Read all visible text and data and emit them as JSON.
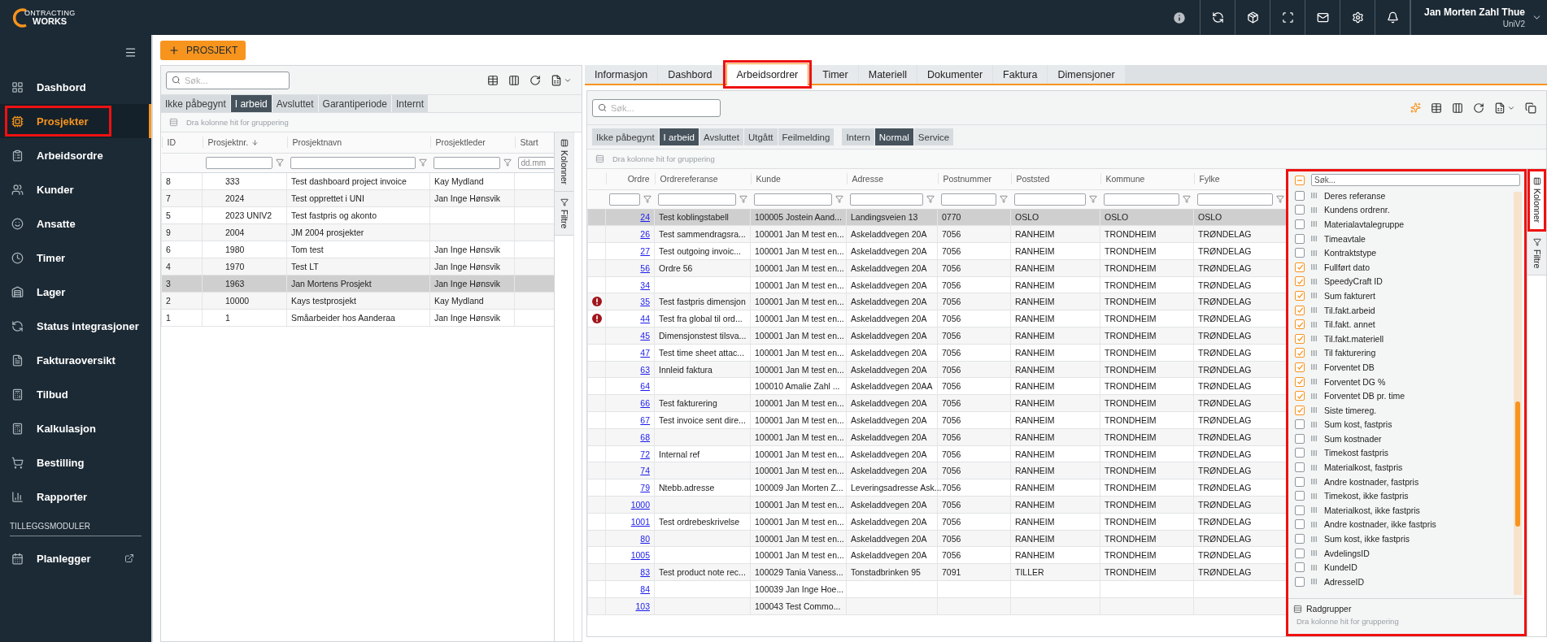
{
  "header": {
    "logo": {
      "line1": "ONTRACTING",
      "line2": "WORKS"
    },
    "user": {
      "name": "Jan Morten Zahl Thue",
      "company": "UniV2"
    }
  },
  "sidebar": {
    "items": [
      {
        "label": "Dashbord",
        "selected": false,
        "highlighted": false
      },
      {
        "label": "Prosjekter",
        "selected": true,
        "highlighted": true
      },
      {
        "label": "Arbeidsordre",
        "selected": false,
        "highlighted": false
      },
      {
        "label": "Kunder",
        "selected": false,
        "highlighted": false
      },
      {
        "label": "Ansatte",
        "selected": false,
        "highlighted": false
      },
      {
        "label": "Timer",
        "selected": false,
        "highlighted": false
      },
      {
        "label": "Lager",
        "selected": false,
        "highlighted": false
      },
      {
        "label": "Status integrasjoner",
        "selected": false,
        "highlighted": false
      },
      {
        "label": "Fakturaoversikt",
        "selected": false,
        "highlighted": false
      },
      {
        "label": "Tilbud",
        "selected": false,
        "highlighted": false
      },
      {
        "label": "Kalkulasjon",
        "selected": false,
        "highlighted": false
      },
      {
        "label": "Bestilling",
        "selected": false,
        "highlighted": false
      },
      {
        "label": "Rapporter",
        "selected": false,
        "highlighted": false
      }
    ],
    "section_title": "TILLEGGSMODULER",
    "module_items": [
      {
        "label": "Planlegger",
        "selected": false
      }
    ]
  },
  "new_project_button": "PROSJEKT",
  "project_list": {
    "search": {
      "placeholder": "Søk..."
    },
    "status_tabs": [
      {
        "label": "Ikke påbegynt",
        "selected": false
      },
      {
        "label": "I arbeid",
        "selected": true
      },
      {
        "label": "Avsluttet",
        "selected": false
      },
      {
        "label": "Garantiperiode",
        "selected": false
      },
      {
        "label": "Internt",
        "selected": false
      }
    ],
    "group_hint": "Dra kolonne hit for gruppering",
    "columns": [
      {
        "label": "ID",
        "sorted": false,
        "kind": "plain"
      },
      {
        "label": "Prosjektnr.",
        "sorted": true,
        "kind": "text"
      },
      {
        "label": "Prosjektnavn",
        "sorted": false,
        "kind": "text"
      },
      {
        "label": "Prosjektleder",
        "sorted": false,
        "kind": "text"
      },
      {
        "label": "Start",
        "sorted": false,
        "kind": "date",
        "placeholder": "dd.mm"
      }
    ],
    "rows": [
      {
        "cells": [
          "8",
          "333",
          "Test dashboard project invoice",
          "Kay Mydland"
        ],
        "selected": false
      },
      {
        "cells": [
          "7",
          "2024",
          "Test opprettet i UNI",
          "Jan Inge Hønsvik"
        ],
        "selected": false
      },
      {
        "cells": [
          "5",
          "2023 UNIV2",
          "Test fastpris og akonto"
        ],
        "selected": false
      },
      {
        "cells": [
          "9",
          "2004",
          "JM 2004 prosjekter"
        ],
        "selected": false
      },
      {
        "cells": [
          "6",
          "1980",
          "Tom test",
          "Jan Inge Hønsvik"
        ],
        "selected": false
      },
      {
        "cells": [
          "4",
          "1970",
          "Test LT",
          "Jan Inge Hønsvik"
        ],
        "selected": false
      },
      {
        "cells": [
          "3",
          "1963",
          "Jan Mortens Prosjekt",
          "Jan Inge Hønsvik"
        ],
        "selected": true
      },
      {
        "cells": [
          "2",
          "10000",
          "Kays testprosjekt",
          "Kay Mydland"
        ],
        "selected": false
      },
      {
        "cells": [
          "1",
          "1",
          "Småarbeider hos Aanderaa",
          "Jan Inge Hønsvik"
        ],
        "selected": false
      }
    ],
    "side_tabs": [
      {
        "label": "Kolonner",
        "selected": false
      },
      {
        "label": "Filtre",
        "selected": false
      }
    ]
  },
  "detail_tabs": [
    {
      "label": "Informasjon",
      "selected": false,
      "highlighted": false
    },
    {
      "label": "Dashbord",
      "selected": false,
      "highlighted": false
    },
    {
      "label": "Arbeidsordrer",
      "selected": true,
      "highlighted": true
    },
    {
      "label": "Timer",
      "selected": false,
      "highlighted": false
    },
    {
      "label": "Materiell",
      "selected": false,
      "highlighted": false
    },
    {
      "label": "Dokumenter",
      "selected": false,
      "highlighted": false
    },
    {
      "label": "Faktura",
      "selected": false,
      "highlighted": false
    },
    {
      "label": "Dimensjoner",
      "selected": false,
      "highlighted": false
    }
  ],
  "work_orders": {
    "search": {
      "placeholder": "Søk..."
    },
    "status_filters": [
      {
        "label": "Ikke påbegynt",
        "selected": false
      },
      {
        "label": "I arbeid",
        "selected": true
      },
      {
        "label": "Avsluttet",
        "selected": false
      },
      {
        "label": "Utgått",
        "selected": false
      },
      {
        "label": "Feilmelding",
        "selected": false
      }
    ],
    "type_filters": [
      {
        "label": "Intern",
        "selected": false
      },
      {
        "label": "Normal",
        "selected": true
      },
      {
        "label": "Service",
        "selected": false
      }
    ],
    "group_hint": "Dra kolonne hit for gruppering",
    "columns": [
      {
        "label": "Ordre"
      },
      {
        "label": "Ordrereferanse"
      },
      {
        "label": "Kunde"
      },
      {
        "label": "Adresse"
      },
      {
        "label": "Postnummer"
      },
      {
        "label": "Poststed"
      },
      {
        "label": "Kommune"
      },
      {
        "label": "Fylke"
      }
    ],
    "rows": [
      {
        "error": false,
        "selected": true,
        "cells": [
          "24",
          "Test koblingstabell",
          "100005 Jostein Aand...",
          "Landingsveien 13",
          "0770",
          "OSLO",
          "OSLO",
          "OSLO"
        ]
      },
      {
        "error": false,
        "selected": false,
        "cells": [
          "26",
          "Test sammendragsra...",
          "100001 Jan M test en...",
          "Askeladdvegen 20A",
          "7056",
          "RANHEIM",
          "TRONDHEIM",
          "TRØNDELAG"
        ]
      },
      {
        "error": false,
        "selected": false,
        "cells": [
          "27",
          "Test outgoing invoic...",
          "100001 Jan M test en...",
          "Askeladdvegen 20A",
          "7056",
          "RANHEIM",
          "TRONDHEIM",
          "TRØNDELAG"
        ]
      },
      {
        "error": false,
        "selected": false,
        "cells": [
          "56",
          "Ordre 56",
          "100001 Jan M test en...",
          "Askeladdvegen 20A",
          "7056",
          "RANHEIM",
          "TRONDHEIM",
          "TRØNDELAG"
        ]
      },
      {
        "error": false,
        "selected": false,
        "cells": [
          "34",
          null,
          "100001 Jan M test en...",
          "Askeladdvegen 20A",
          "7056",
          "RANHEIM",
          "TRONDHEIM",
          "TRØNDELAG"
        ]
      },
      {
        "error": true,
        "selected": false,
        "cells": [
          "35",
          "Test fastpris dimensjon",
          "100001 Jan M test en...",
          "Askeladdvegen 20A",
          "7056",
          "RANHEIM",
          "TRONDHEIM",
          "TRØNDELAG"
        ]
      },
      {
        "error": true,
        "selected": false,
        "cells": [
          "44",
          "Test fra global til ord...",
          "100001 Jan M test en...",
          "Askeladdvegen 20A",
          "7056",
          "RANHEIM",
          "TRONDHEIM",
          "TRØNDELAG"
        ]
      },
      {
        "error": false,
        "selected": false,
        "cells": [
          "45",
          "Dimensjonstest tilsva...",
          "100001 Jan M test en...",
          "Askeladdvegen 20A",
          "7056",
          "RANHEIM",
          "TRONDHEIM",
          "TRØNDELAG"
        ]
      },
      {
        "error": false,
        "selected": false,
        "cells": [
          "47",
          "Test time sheet attac...",
          "100001 Jan M test en...",
          "Askeladdvegen 20A",
          "7056",
          "RANHEIM",
          "TRONDHEIM",
          "TRØNDELAG"
        ]
      },
      {
        "error": false,
        "selected": false,
        "cells": [
          "63",
          "Innleid faktura",
          "100001 Jan M test en...",
          "Askeladdvegen 20A",
          "7056",
          "RANHEIM",
          "TRONDHEIM",
          "TRØNDELAG"
        ]
      },
      {
        "error": false,
        "selected": false,
        "cells": [
          "64",
          null,
          "100010 Amalie Zahl ...",
          "Askeladdvegen 20AA",
          "7056",
          "RANHEIM",
          "TRONDHEIM",
          "TRØNDELAG"
        ]
      },
      {
        "error": false,
        "selected": false,
        "cells": [
          "66",
          "Test fakturering",
          "100001 Jan M test en...",
          "Askeladdvegen 20A",
          "7056",
          "RANHEIM",
          "TRONDHEIM",
          "TRØNDELAG"
        ]
      },
      {
        "error": false,
        "selected": false,
        "cells": [
          "67",
          "Test invoice sent dire...",
          "100001 Jan M test en...",
          "Askeladdvegen 20A",
          "7056",
          "RANHEIM",
          "TRONDHEIM",
          "TRØNDELAG"
        ]
      },
      {
        "error": false,
        "selected": false,
        "cells": [
          "68",
          null,
          "100001 Jan M test en...",
          "Askeladdvegen 20A",
          "7056",
          "RANHEIM",
          "TRONDHEIM",
          "TRØNDELAG"
        ]
      },
      {
        "error": false,
        "selected": false,
        "cells": [
          "72",
          "Internal ref",
          "100001 Jan M test en...",
          "Askeladdvegen 20A",
          "7056",
          "RANHEIM",
          "TRONDHEIM",
          "TRØNDELAG"
        ]
      },
      {
        "error": false,
        "selected": false,
        "cells": [
          "74",
          null,
          "100001 Jan M test en...",
          "Askeladdvegen 20A",
          "7056",
          "RANHEIM",
          "TRONDHEIM",
          "TRØNDELAG"
        ]
      },
      {
        "error": false,
        "selected": false,
        "cells": [
          "79",
          "Ntebb.adresse",
          "100009 Jan Morten Z...",
          "Leveringsadresse Ask...",
          "7056",
          "RANHEIM",
          "TRONDHEIM",
          "TRØNDELAG"
        ]
      },
      {
        "error": false,
        "selected": false,
        "cells": [
          "1000",
          null,
          "100001 Jan M test en...",
          "Askeladdvegen 20A",
          "7056",
          "RANHEIM",
          "TRONDHEIM",
          "TRØNDELAG"
        ]
      },
      {
        "error": false,
        "selected": false,
        "cells": [
          "1001",
          "Test ordrebeskrivelse",
          "100001 Jan M test en...",
          "Askeladdvegen 20A",
          "7056",
          "RANHEIM",
          "TRONDHEIM",
          "TRØNDELAG"
        ]
      },
      {
        "error": false,
        "selected": false,
        "cells": [
          "80",
          null,
          "100001 Jan M test en...",
          "Askeladdvegen 20A",
          "7056",
          "RANHEIM",
          "TRONDHEIM",
          "TRØNDELAG"
        ]
      },
      {
        "error": false,
        "selected": false,
        "cells": [
          "1005",
          null,
          "100001 Jan M test en...",
          "Askeladdvegen 20A",
          "7056",
          "RANHEIM",
          "TRONDHEIM",
          "TRØNDELAG"
        ]
      },
      {
        "error": false,
        "selected": false,
        "cells": [
          "83",
          "Test product note rec...",
          "100029 Tania Vaness...",
          "Tonstadbrinken 95",
          "7091",
          "TILLER",
          "TRONDHEIM",
          "TRØNDELAG"
        ]
      },
      {
        "error": false,
        "selected": false,
        "cells": [
          "84",
          null,
          "100039 Jan Inge Hoe..."
        ]
      },
      {
        "error": false,
        "selected": false,
        "cells": [
          "103",
          null,
          "100043 Test Commo..."
        ]
      }
    ],
    "columns_panel": {
      "highlighted": true,
      "select_all": {
        "mixed": true
      },
      "search": {
        "placeholder": "Søk..."
      },
      "items": [
        {
          "label": "Deres referanse",
          "checked": false
        },
        {
          "label": "Kundens ordrenr.",
          "checked": false
        },
        {
          "label": "Materialavtalegruppe",
          "checked": false
        },
        {
          "label": "Timeavtale",
          "checked": false
        },
        {
          "label": "Kontraktstype",
          "checked": false
        },
        {
          "label": "Fullført dato",
          "checked": true
        },
        {
          "label": "SpeedyCraft ID",
          "checked": true
        },
        {
          "label": "Sum fakturert",
          "checked": true
        },
        {
          "label": "Til.fakt.arbeid",
          "checked": true
        },
        {
          "label": "Til.fakt. annet",
          "checked": true
        },
        {
          "label": "Til.fakt.materiell",
          "checked": true
        },
        {
          "label": "Til fakturering",
          "checked": true
        },
        {
          "label": "Forventet DB",
          "checked": true
        },
        {
          "label": "Forventet DG %",
          "checked": true
        },
        {
          "label": "Forventet DB pr. time",
          "checked": true
        },
        {
          "label": "Siste timereg.",
          "checked": true
        },
        {
          "label": "Sum kost, fastpris",
          "checked": false
        },
        {
          "label": "Sum kostnader",
          "checked": false
        },
        {
          "label": "Timekost fastpris",
          "checked": false
        },
        {
          "label": "Materialkost, fastpris",
          "checked": false
        },
        {
          "label": "Andre kostnader, fastpris",
          "checked": false
        },
        {
          "label": "Timekost, ikke fastpris",
          "checked": false
        },
        {
          "label": "Materialkost, ikke fastpris",
          "checked": false
        },
        {
          "label": "Andre kostnader, ikke fastpris",
          "checked": false
        },
        {
          "label": "Sum kost, ikke fastpris",
          "checked": false
        },
        {
          "label": "AvdelingsID",
          "checked": false
        },
        {
          "label": "KundeID",
          "checked": false
        },
        {
          "label": "AdresseID",
          "checked": false
        }
      ],
      "row_groups": {
        "title": "Radgrupper",
        "hint": "Dra kolonne hit for gruppering"
      }
    },
    "side_tabs": [
      {
        "label": "Kolonner",
        "selected": true,
        "highlighted": true
      },
      {
        "label": "Filtre",
        "selected": false,
        "highlighted": false
      }
    ]
  }
}
